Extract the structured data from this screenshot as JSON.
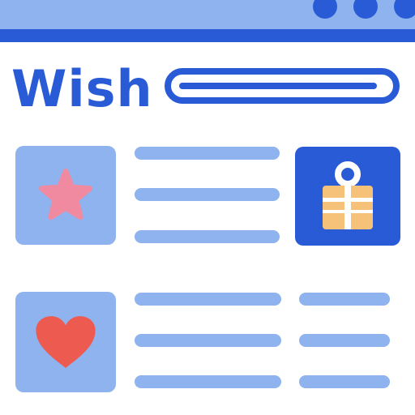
{
  "header": {
    "title": "Wish"
  },
  "window_controls": [
    "window-dot-1",
    "window-dot-2",
    "window-dot-3"
  ],
  "list": {
    "items": [
      {
        "icon": "star-icon",
        "detail": "gift-icon"
      },
      {
        "icon": "heart-icon"
      }
    ]
  },
  "colors": {
    "primary": "#2A5BD7",
    "light": "#8FB3EE",
    "star": "#F08AA0",
    "heart": "#EC5A50",
    "gift": "#F6C27A"
  }
}
